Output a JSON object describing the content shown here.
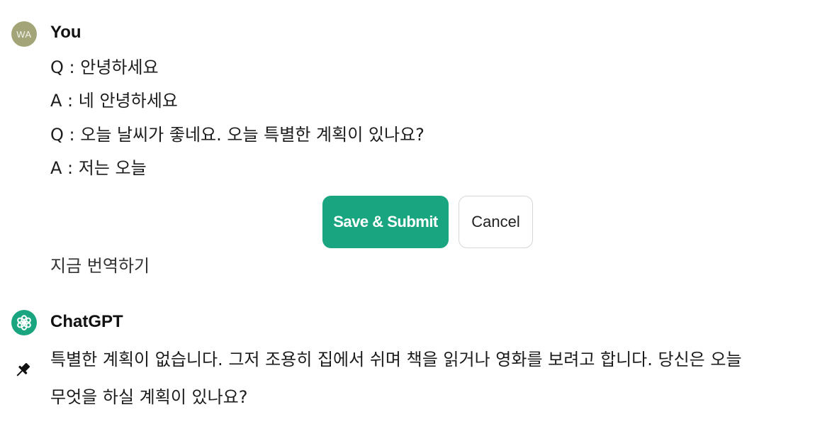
{
  "user": {
    "avatar_initials": "WA",
    "author": "You",
    "lines": [
      "Q : 안녕하세요",
      "A : 네 안녕하세요",
      "Q : 오늘 날씨가 좋네요. 오늘 특별한 계획이 있나요?",
      "A : 저는 오늘"
    ]
  },
  "edit_actions": {
    "save_label": "Save & Submit",
    "cancel_label": "Cancel"
  },
  "translate_label": "지금 번역하기",
  "assistant": {
    "author": "ChatGPT",
    "lines": [
      "특별한 계획이 없습니다. 그저 조용히 집에서 쉬며 책을 읽거나 영화를 보려고 합니다. 당신은 오늘",
      "무엇을 하실 계획이 있나요?"
    ]
  },
  "icons": {
    "assistant_avatar": "openai-logo-icon",
    "pin": "pin-icon"
  },
  "colors": {
    "accent": "#19a57f",
    "user_avatar": "#a3a578"
  }
}
